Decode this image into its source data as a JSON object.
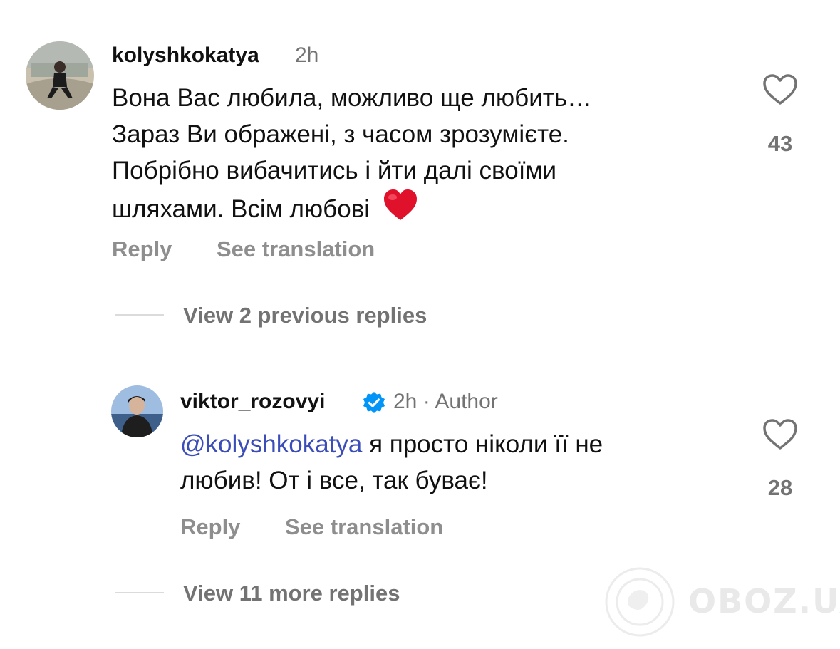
{
  "comment": {
    "username": "kolyshkokatya",
    "time": "2h",
    "lines": [
      "Вона Вас любила, можливо ще любить…",
      "Зараз Ви ображені, з часом зрозумієте.",
      "Побрібно вибачитись і йти далі своїми",
      "шляхами. Всім любові"
    ],
    "emoji": "heart-emoji",
    "like_count": "43",
    "reply_label": "Reply",
    "translation_label": "See translation"
  },
  "view_previous": "View 2 previous replies",
  "reply": {
    "username": "viktor_rozovyi",
    "time": "2h · Author",
    "mention": "@kolyshkokatya",
    "line1_rest": " я просто ніколи її не",
    "line2": "любив! От і все, так буває!",
    "like_count": "28",
    "reply_label": "Reply",
    "translation_label": "See translation"
  },
  "view_more": "View 11 more replies",
  "watermark": "OBOZ.UA",
  "colors": {
    "mention": "#3b4db8",
    "verified": "#0095f6",
    "heart": "#e0112b",
    "secondary": "#737373"
  }
}
